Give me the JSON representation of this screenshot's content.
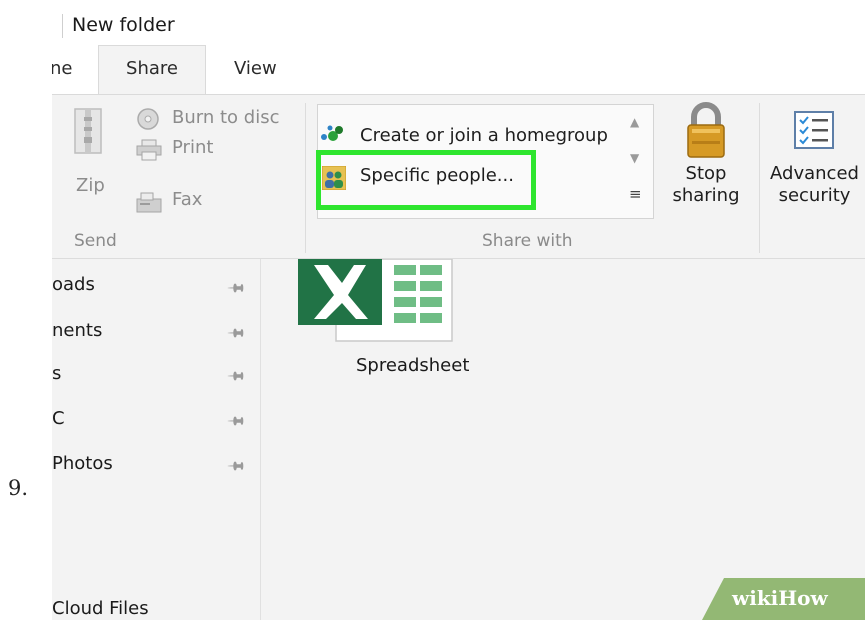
{
  "step_number": "9.",
  "window": {
    "title": "New folder",
    "tabs": [
      {
        "label": "ne"
      },
      {
        "label": "Share"
      },
      {
        "label": "View"
      }
    ]
  },
  "ribbon": {
    "send": {
      "zip": "Zip",
      "burn": "Burn to disc",
      "print": "Print",
      "fax": "Fax",
      "label": "Send"
    },
    "share_with": {
      "items": [
        "Create or join a homegroup",
        "Specific people..."
      ],
      "label": "Share with"
    },
    "stop_sharing": {
      "line1": "Stop",
      "line2": "sharing"
    },
    "advanced_security": {
      "line1": "Advanced",
      "line2": "security"
    }
  },
  "nav": {
    "items": [
      {
        "label": "oads"
      },
      {
        "label": "nents"
      },
      {
        "label": "s"
      },
      {
        "label": "C"
      },
      {
        "label": "Photos"
      },
      {
        "label": "Cloud Files"
      }
    ]
  },
  "content": {
    "file_label": "Spreadsheet"
  },
  "watermark": {
    "text_a": "wiki",
    "text_b": "How"
  },
  "colors": {
    "highlight": "#2ee52e",
    "excel_green": "#217346",
    "watermark_green": "#93b874"
  }
}
